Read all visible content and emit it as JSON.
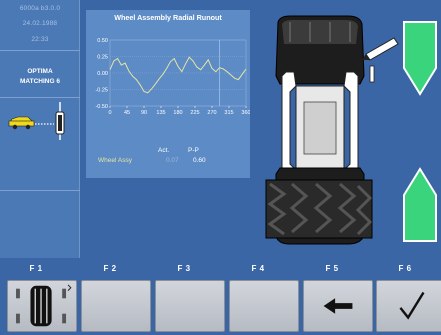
{
  "status": {
    "line1": "6000a    b3.0.0",
    "date": "24.02.1988",
    "time": "22:33"
  },
  "program": {
    "line1": "OPTIMA",
    "line2": "MATCHING 6"
  },
  "chart_data": {
    "type": "line",
    "title": "Wheel Assembly Radial Runout",
    "x_ticks": [
      "0",
      "45",
      "90",
      "135",
      "180",
      "225",
      "270",
      "315",
      "360"
    ],
    "y_ticks": [
      "0.50",
      "0.25",
      "0.00",
      "-0.25",
      "-0.50"
    ],
    "xlim": [
      0,
      360
    ],
    "ylim": [
      -0.5,
      0.5
    ],
    "marker_x": 290,
    "series": [
      {
        "name": "Wheel Assy",
        "x": [
          0,
          10,
          20,
          30,
          40,
          50,
          60,
          70,
          80,
          90,
          100,
          110,
          120,
          130,
          140,
          150,
          160,
          170,
          180,
          190,
          200,
          210,
          220,
          230,
          240,
          250,
          260,
          270,
          280,
          290,
          300,
          310,
          320,
          330,
          340,
          350,
          360
        ],
        "values": [
          0.05,
          0.18,
          0.22,
          0.12,
          0.15,
          0.03,
          -0.05,
          -0.1,
          -0.18,
          -0.28,
          -0.3,
          -0.24,
          -0.17,
          -0.09,
          -0.02,
          0.07,
          0.17,
          0.22,
          0.1,
          0.02,
          0.14,
          0.24,
          0.18,
          0.09,
          0.05,
          0.12,
          0.2,
          0.07,
          0.02,
          0.08,
          0.06,
          0.02,
          -0.03,
          -0.08,
          -0.1,
          -0.02,
          0.06
        ]
      }
    ],
    "colors": {
      "line": "#e4e5a2",
      "grid": "#8fb0dc",
      "marker": "#9fc0ea"
    }
  },
  "legend": {
    "col_act": "Act.",
    "col_pp": "P-P",
    "row_label": "Wheel Assy",
    "act_value": "0.07",
    "pp_value": "0.60"
  },
  "softkeys": [
    {
      "label": "F 1",
      "icon": "tire-icon"
    },
    {
      "label": "F 2",
      "icon": ""
    },
    {
      "label": "F 3",
      "icon": ""
    },
    {
      "label": "F 4",
      "icon": ""
    },
    {
      "label": "F 5",
      "icon": "arrow-left-icon"
    },
    {
      "label": "F 6",
      "icon": "check-icon"
    }
  ],
  "arrow_color": "#39d47c"
}
